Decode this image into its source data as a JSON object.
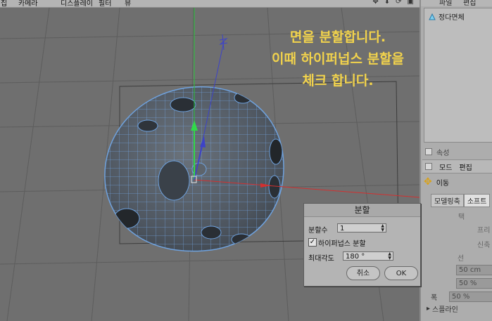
{
  "menubar": {
    "items": [
      "집",
      "카메라",
      "디스플레이",
      "필터",
      "뷰"
    ]
  },
  "viewport_icons": [
    "move-view-icon",
    "zoom-view-icon",
    "rotate-view-icon",
    "maximize-view-icon"
  ],
  "callout": {
    "line1": "면을 분할합니다.",
    "line2": "이때 하이퍼넙스 분할을",
    "line3": "체크 합니다.",
    "color": "#f2d34c"
  },
  "objects_panel": {
    "menu": [
      "파일",
      "편집"
    ],
    "items": [
      {
        "label": "정다면체",
        "icon": "platonic-icon"
      }
    ]
  },
  "attributes_panel": {
    "title": "속성",
    "menu": [
      "모드",
      "편집"
    ],
    "tool_name": "이동",
    "tabs": [
      "모델링축",
      "소프트"
    ],
    "ghost_labels": [
      "택",
      "프리",
      "신축",
      "선",
      "50 cm",
      "50 %",
      "폭 ",
      "50 %",
      "스플라인"
    ]
  },
  "dialog": {
    "title": "분할",
    "subdivision_label": "분할수",
    "subdivision_value": "1",
    "hypernurbs_label": "하이퍼넙스 분할",
    "hypernurbs_checked": true,
    "max_angle_label": "최대각도",
    "max_angle_value": "180 °",
    "cancel_label": "취소",
    "ok_label": "OK"
  },
  "colors": {
    "viewport_bg": "#6f6f6f",
    "mesh_fill": "#525a62",
    "mesh_wire": "#6fa2de",
    "axis_y": "#27c43a",
    "axis_x": "#d33030",
    "axis_z": "#3d43c7"
  }
}
